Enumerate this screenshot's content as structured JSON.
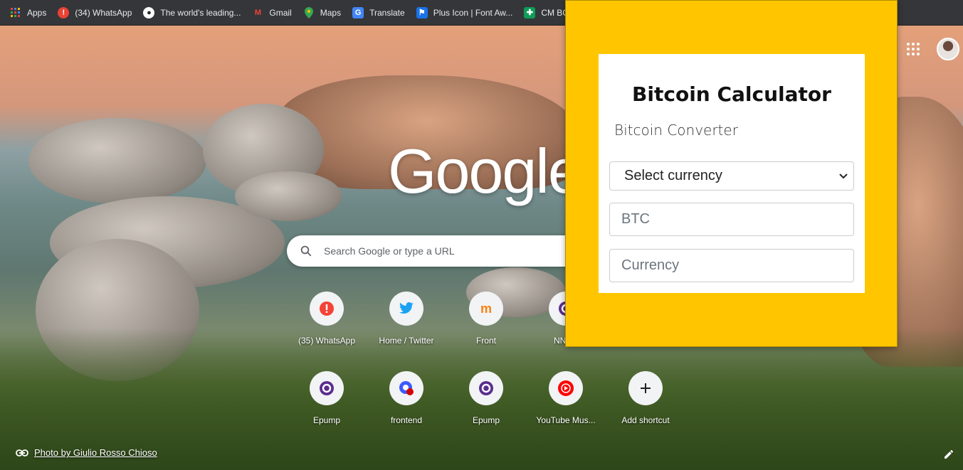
{
  "bookmarks": [
    {
      "label": "Apps",
      "icon": "apps-grid-icon",
      "color": "#ea4335"
    },
    {
      "label": "(34) WhatsApp",
      "icon": "alert-icon",
      "color": "#ea4335"
    },
    {
      "label": "The world's leading...",
      "icon": "github-icon",
      "color": "#ffffff"
    },
    {
      "label": "Gmail",
      "icon": "gmail-icon",
      "color": "#ea4335"
    },
    {
      "label": "Maps",
      "icon": "maps-icon",
      "color": "#34a853"
    },
    {
      "label": "Translate",
      "icon": "translate-icon",
      "color": "#4285f4"
    },
    {
      "label": "Plus Icon | Font Aw...",
      "icon": "flag-icon",
      "color": "#1a73e8"
    },
    {
      "label": "CM BOA",
      "icon": "cross-icon",
      "color": "#0f9d58"
    }
  ],
  "newtab": {
    "logo_text": "Google",
    "search_placeholder": "Search Google or type a URL",
    "shortcuts": [
      {
        "label": "(35) WhatsApp",
        "icon": "alert-icon"
      },
      {
        "label": "Home / Twitter",
        "icon": "twitter-icon"
      },
      {
        "label": "Front",
        "icon": "moodle-icon"
      },
      {
        "label": "NNPC",
        "icon": "epump-icon"
      },
      {
        "label": "Epump",
        "icon": "epump-icon"
      },
      {
        "label": "frontend",
        "icon": "frontend-icon"
      },
      {
        "label": "Epump",
        "icon": "epump-icon"
      },
      {
        "label": "YouTube Mus...",
        "icon": "youtube-music-icon"
      },
      {
        "label": "Add shortcut",
        "icon": "plus-icon"
      }
    ],
    "photo_credit": "Photo by Giulio Rosso Chioso"
  },
  "popup": {
    "title": "Bitcoin Calculator",
    "subtitle": "Bitcoin Converter",
    "select_label": "Select currency",
    "btc_placeholder": "BTC",
    "currency_placeholder": "Currency",
    "background_color": "#ffc600"
  }
}
